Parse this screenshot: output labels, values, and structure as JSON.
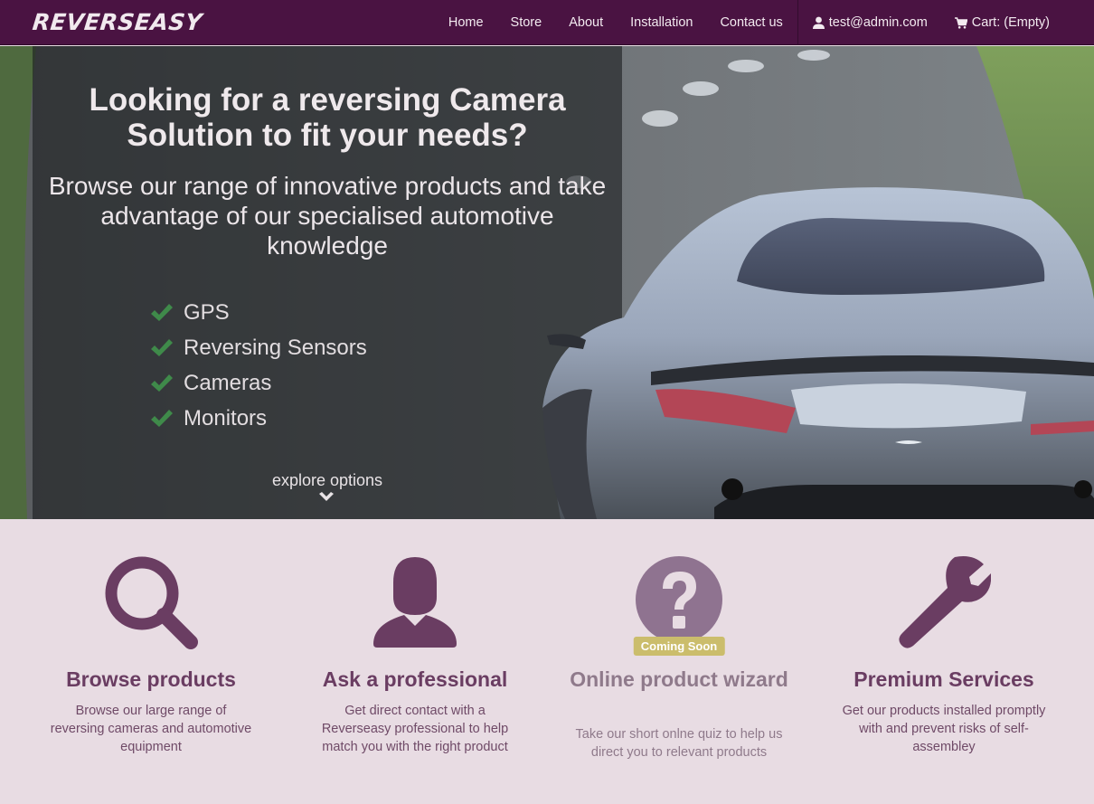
{
  "brand": {
    "name": "Reverseasy"
  },
  "nav": {
    "links": [
      "Home",
      "Store",
      "About",
      "Installation",
      "Contact us"
    ],
    "user_email": "test@admin.com",
    "cart_label": "Cart: (Empty)"
  },
  "hero": {
    "title": "Looking for a reversing Camera Solution to fit your needs?",
    "subtitle": "Browse our range of innovative products and take advantage of our specialised automotive knowledge",
    "features": [
      "GPS",
      "Reversing Sensors",
      "Cameras",
      "Monitors"
    ],
    "explore_label": "explore options"
  },
  "services": [
    {
      "icon": "search-icon",
      "title": "Browse products",
      "desc": "Browse our large range of reversing cameras and automotive equipment"
    },
    {
      "icon": "user-icon",
      "title": "Ask a professional",
      "desc": "Get direct contact with a Reverseasy professional to help match you with the right product"
    },
    {
      "icon": "question-circle-icon",
      "title": "Online product wizard",
      "desc": "Take our short onlne quiz to help us direct you to relevant products",
      "badge": "Coming Soon"
    },
    {
      "icon": "wrench-icon",
      "title": "Premium Services",
      "desc": "Get our products installed promptly with and prevent risks of self-assembley"
    }
  ],
  "colors": {
    "navbar": "#4a1342",
    "accent": "#6a3d62",
    "check": "#3f8a4a",
    "badge": "#cbbd6c",
    "background": "#e8dce3"
  }
}
